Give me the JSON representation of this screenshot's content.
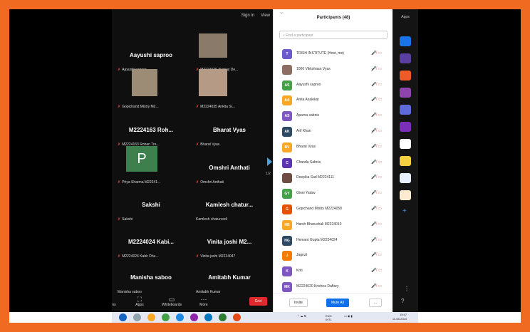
{
  "meeting": {
    "sign_in": "Sign in",
    "view": "View",
    "page_indicator": "1/2",
    "tiles": [
      {
        "name": "Aayushi saproo",
        "sub": "Aayushi saproo",
        "muted": true
      },
      {
        "name": "",
        "sub": "M2224025 Akshay De...",
        "muted": true
      },
      {
        "name": "",
        "sub": "Gopichand Mistry M2...",
        "muted": true
      },
      {
        "name": "",
        "sub": "M2224035 Ankita Si...",
        "muted": true
      },
      {
        "name": "M2224163 Roh...",
        "sub": "M2224163 Rohan Tre...",
        "muted": true
      },
      {
        "name": "Bharat Vyas",
        "sub": "Bharat Vyas",
        "muted": true
      },
      {
        "name": "",
        "sub": "Priya Sharma M22241...",
        "muted": true
      },
      {
        "name": "Omshri Anthati",
        "sub": "Omshri Anthati",
        "muted": true
      },
      {
        "name": "Sakshi",
        "sub": "Sakshi",
        "muted": true
      },
      {
        "name": "Kamlesh chatur...",
        "sub": "Kamlesh chaturvedi",
        "muted": false
      },
      {
        "name": "M2224024 Kabi...",
        "sub": "M2224024 Kabir Dhu...",
        "muted": true
      },
      {
        "name": "Vinita joshi M2...",
        "sub": "Vinita joshi M2224047",
        "muted": true
      },
      {
        "name": "Manisha saboo",
        "sub": "Manisha saboo",
        "muted": false
      },
      {
        "name": "Amitabh Kumar",
        "sub": "Amitabh Kumar",
        "muted": false
      }
    ],
    "avatar_letter": "P",
    "bottom": {
      "left_label": "ns",
      "apps": "Apps",
      "whiteboards": "Whiteboards",
      "more": "More",
      "end": "End"
    }
  },
  "panel": {
    "title": "Participants (48)",
    "search_placeholder": "Find a participant",
    "participants": [
      {
        "initials": "T",
        "name": "TRISH INSTITUTE (Host, me)",
        "color": "#6a5acd"
      },
      {
        "initials": "",
        "name": "1000 Vikkshaan Vyas",
        "color": "#8d6e63"
      },
      {
        "initials": "AS",
        "name": "Aayushi saproo",
        "color": "#43a047"
      },
      {
        "initials": "AA",
        "name": "Anita Asalekar",
        "color": "#f9a825"
      },
      {
        "initials": "AS",
        "name": "Aparna sabnis",
        "color": "#7e57c2"
      },
      {
        "initials": "AK",
        "name": "Arif Khan",
        "color": "#2e4a62"
      },
      {
        "initials": "BV",
        "name": "Bharat Vyas",
        "color": "#f9a825"
      },
      {
        "initials": "C",
        "name": "Chanda Sabnis",
        "color": "#5e35b1"
      },
      {
        "initials": "",
        "name": "Deepika Sad M2224111",
        "color": "#6d4c41"
      },
      {
        "initials": "GY",
        "name": "Ginni Yadav",
        "color": "#43a047"
      },
      {
        "initials": "G",
        "name": "Gopichand Mistry M2224058",
        "color": "#e65100"
      },
      {
        "initials": "HB",
        "name": "Harsh Bharushali M2224010",
        "color": "#f9a825"
      },
      {
        "initials": "HG",
        "name": "Hemant Gupta M2224024",
        "color": "#2e4a62"
      },
      {
        "initials": "J",
        "name": "Jagruti",
        "color": "#f57c00"
      },
      {
        "initials": "K",
        "name": "Kriti",
        "color": "#7e57c2"
      },
      {
        "initials": "MK",
        "name": "M2224020 Krishna Daftary",
        "color": "#7e57c2"
      }
    ],
    "invite": "Invite",
    "mute_all": "Mute All",
    "more": "..."
  },
  "apps_panel": {
    "label": "Apps"
  },
  "taskbar": {
    "lang": "ENG",
    "lang2": "INTL",
    "time": "15:47",
    "date": "11-08-2023"
  }
}
